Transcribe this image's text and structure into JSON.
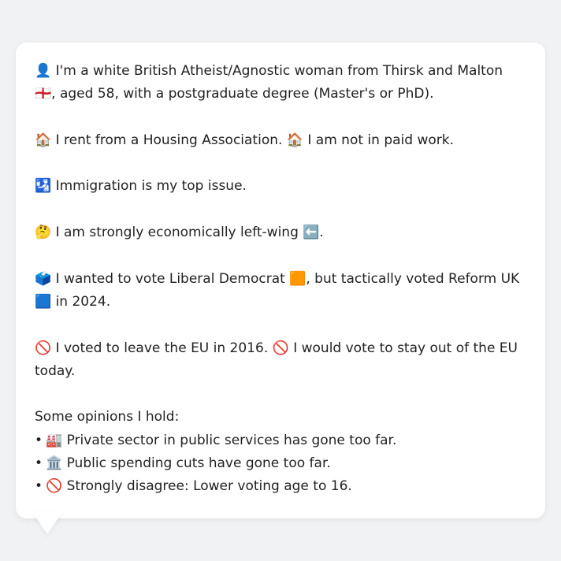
{
  "profile": {
    "line1": "👤 I'm a white British Atheist/Agnostic woman from Thirsk and Malton 🏴󠁧󠁢󠁥󠁮󠁧󠁿, aged 58, with a postgraduate degree (Master's or PhD).",
    "line2": "🏠 I rent from a Housing Association. 🏠 I am not in paid work.",
    "line3": "🛂 Immigration is my top issue.",
    "line4": "🤔 I am strongly economically left-wing ⬅️.",
    "line5": "🗳️ I wanted to vote Liberal Democrat 🟧, but tactically voted Reform UK 🟦 in 2024.",
    "line6": "🚫 I voted to leave the EU in 2016. 🚫 I would vote to stay out of the EU today."
  },
  "opinions": {
    "heading": "Some opinions I hold:",
    "bullet": "•",
    "items": [
      "🏭 Private sector in public services has gone too far.",
      "🏛️ Public spending cuts have gone too far.",
      "🚫 Strongly disagree: Lower voting age to 16."
    ]
  }
}
